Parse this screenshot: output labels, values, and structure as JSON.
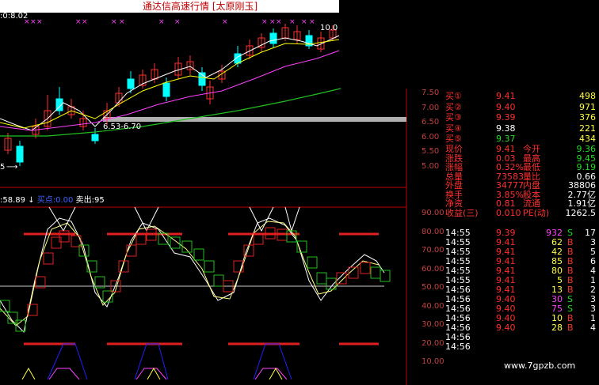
{
  "title": "通达信高速行情 [太原刚玉]",
  "main_chart": {
    "top_left_label": ":0:8.02",
    "price_right_label": "10.0",
    "band_label": "6.53-6.70",
    "bottom_left_label": "5",
    "y_ticks": [
      "7.50",
      "7.00",
      "6.50",
      "6.00",
      "5.50",
      "5.00"
    ]
  },
  "indicator": {
    "left_label": ":58.89",
    "arrow": "↓",
    "buy_label": "买点:0.00",
    "sell_label": "卖出:95",
    "y_ticks": [
      "90.00",
      "80.00",
      "70.00",
      "60.00",
      "50.00",
      "40.00",
      "30.00",
      "20.00",
      "10.00"
    ]
  },
  "quote": {
    "bids": [
      {
        "label": "买①",
        "price": "9.41",
        "vol": "498"
      },
      {
        "label": "买②",
        "price": "9.40",
        "vol": "971"
      },
      {
        "label": "买③",
        "price": "9.39",
        "vol": "376"
      },
      {
        "label": "买④",
        "price": "9.38",
        "vol": "221"
      },
      {
        "label": "买⑤",
        "price": "9.37",
        "vol": "434"
      }
    ],
    "stats": [
      {
        "l1": "现价",
        "v1": "9.41",
        "l2": "今开",
        "v2": "9.36"
      },
      {
        "l1": "涨跌",
        "v1": "0.03",
        "l2": "最高",
        "v2": "9.45"
      },
      {
        "l1": "涨幅",
        "v1": "0.32%",
        "l2": "最低",
        "v2": "9.19"
      },
      {
        "l1": "总量",
        "v1": "73583",
        "l2": "量比",
        "v2": "0.66"
      },
      {
        "l1": "外盘",
        "v1": "34777",
        "l2": "内盘",
        "v2": "38806"
      },
      {
        "l1": "换手",
        "v1": "3.85%",
        "l2": "股本",
        "v2": "2.77亿"
      },
      {
        "l1": "净资",
        "v1": "0.81",
        "l2": "流通",
        "v2": "1.91亿"
      },
      {
        "l1": "收益(三)",
        "v1": "0.010",
        "l2": "PE(动)",
        "v2": "1262.5"
      }
    ],
    "ticks": [
      {
        "time": "14:55",
        "price": "9.39",
        "vol": "932",
        "side": "S",
        "n": "17"
      },
      {
        "time": "14:55",
        "price": "9.41",
        "vol": "62",
        "side": "B",
        "n": "3"
      },
      {
        "time": "14:55",
        "price": "9.41",
        "vol": "42",
        "side": "B",
        "n": "5"
      },
      {
        "time": "14:55",
        "price": "9.41",
        "vol": "85",
        "side": "B",
        "n": "6"
      },
      {
        "time": "14:55",
        "price": "9.41",
        "vol": "80",
        "side": "B",
        "n": "4"
      },
      {
        "time": "14:55",
        "price": "9.41",
        "vol": "5",
        "side": "B",
        "n": "1"
      },
      {
        "time": "14:56",
        "price": "9.41",
        "vol": "13",
        "side": "B",
        "n": "2"
      },
      {
        "time": "14:56",
        "price": "9.40",
        "vol": "30",
        "side": "S",
        "n": "3"
      },
      {
        "time": "14:56",
        "price": "9.40",
        "vol": "75",
        "side": "S",
        "n": "3"
      },
      {
        "time": "14:56",
        "price": "9.40",
        "vol": "10",
        "side": "B",
        "n": "1"
      },
      {
        "time": "14:56",
        "price": "9.40",
        "vol": "28",
        "side": "B",
        "n": "4"
      },
      {
        "time": "14:56",
        "price": "",
        "vol": "",
        "side": "",
        "n": ""
      },
      {
        "time": "14:56",
        "price": "",
        "vol": "",
        "side": "",
        "n": ""
      }
    ]
  },
  "watermark": "www.7gpzb.com",
  "colors": {
    "up": "#ff3030",
    "down": "#00ffff",
    "ma1": "#ffffff",
    "ma2": "#ffff00",
    "ma3": "#ff40ff",
    "ma4": "#20c020",
    "axis": "#c00000"
  }
}
